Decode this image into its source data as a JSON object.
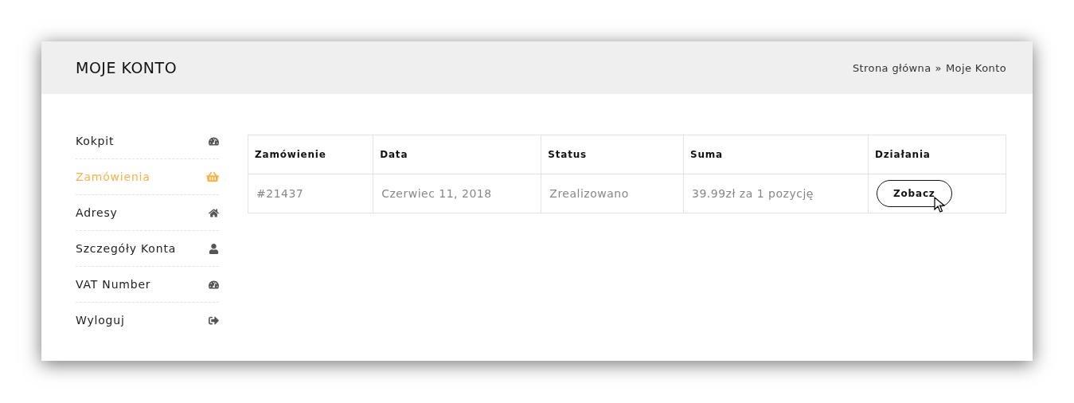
{
  "header": {
    "title": "MOJE KONTO",
    "breadcrumb": {
      "home": "Strona główna",
      "separator": "»",
      "current": "Moje Konto"
    }
  },
  "sidebar": {
    "items": [
      {
        "label": "Kokpit",
        "selected": false
      },
      {
        "label": "Zamówienia",
        "selected": true
      },
      {
        "label": "Adresy",
        "selected": false
      },
      {
        "label": "Szczegóły Konta",
        "selected": false
      },
      {
        "label": "VAT Number",
        "selected": false
      },
      {
        "label": "Wyloguj",
        "selected": false
      }
    ]
  },
  "table": {
    "columns": [
      "Zamówienie",
      "Data",
      "Status",
      "Suma",
      "Działania"
    ],
    "rows": [
      {
        "order": "#21437",
        "date": "Czerwiec 11, 2018",
        "status": "Zrealizowano",
        "total": "39.99zł za 1 pozycję",
        "action": "Zobacz"
      }
    ]
  }
}
